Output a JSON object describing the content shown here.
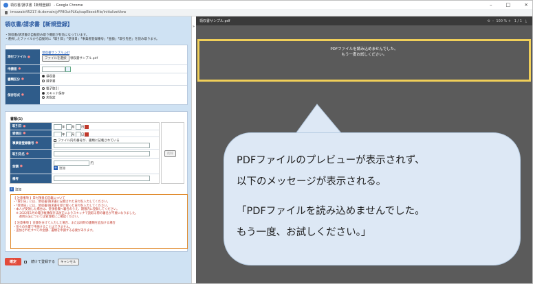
{
  "window": {
    "title": "領収書/請求書【新規登録】 - Google Chrome",
    "url": "imsazabi45217.tk.domain/yFP8OutPLKa/sapEbookFile/initializeView"
  },
  "form": {
    "title": "領収書/請求書【新規登録】",
    "notes": [
      "・領収書/請求書の自動読み取り機能が有効になっています。",
      "・選択したファイルから自動的に「取引日」「受領日」「事業者登録番号」「金額」「取引先名」を読み取ります。"
    ],
    "attach": {
      "label": "添付ファイル",
      "link": "領収書サンプル.pdf",
      "button": "ファイルを選択",
      "filename": "領収書サンプル.pdf"
    },
    "applicant": {
      "label": "申請者"
    },
    "doc_type": {
      "label": "書類区分",
      "options": [
        "領収書",
        "請求書"
      ],
      "selected": "領収書"
    },
    "storage": {
      "label": "保存形式",
      "options": [
        "電子取引",
        "スキャナ保存",
        "未指定"
      ],
      "selected": "スキャナ保存"
    },
    "section_title": "書類(1)",
    "fields": {
      "trade_date": "取引日",
      "receive_date": "受領日",
      "biz_no": "事業者登録番号",
      "partner": "取引先名",
      "amount": "金額",
      "memo": "備考",
      "ymd": [
        "年",
        "月",
        "日"
      ],
      "biz_check": "ファイル内の番号が、書類に記載されている",
      "amount_unit": "円",
      "add": "追加",
      "delete": "削除"
    },
    "add_label": "追加",
    "notice": [
      "【 注意事項 】日付項目の記載について",
      "・「取引日」には、領収書/請求書に記載された日付を入力してください。",
      "・「受領日」には、領収書/請求書を受け取った日付を入力してください。",
      "・本人が受領した場合は、受領者欄へ署名のうえ、期限内に登録してください。",
      "　※ 2022年1月の電子帳簿保存法改正によりスキャナで読取る際の署名が不要になりました。",
      "　　適用方法については管理者にご確認ください。",
      "",
      "【 注意事項 】金額を分けて入力した場合、または同時の書類を追加する場合",
      "・別々の位置で申請することはできません。",
      "・追加されたすべての金額、書類を申請する必要があります。"
    ],
    "submit": {
      "confirm": "確定",
      "continue": "続けて登録する",
      "cancel": "キャンセル"
    }
  },
  "viewer": {
    "filename": "領収書サンプル.pdf",
    "zoom": "100 %",
    "page": "1 / 1",
    "error": [
      "PDFファイルを読み込めませんでした。",
      "もう一度お試しください。"
    ]
  },
  "callout": {
    "lines": [
      "PDFファイルのプレビューが表示されず、",
      "以下のメッセージが表示される。",
      "「PDFファイルを読み込めませんでした。",
      "もう一度、お試しください。」"
    ]
  },
  "colors": {
    "header": "#2f5c8a",
    "accent": "#e24b3b",
    "highlight": "#f0cf59",
    "bubble": "#dde8f5"
  }
}
